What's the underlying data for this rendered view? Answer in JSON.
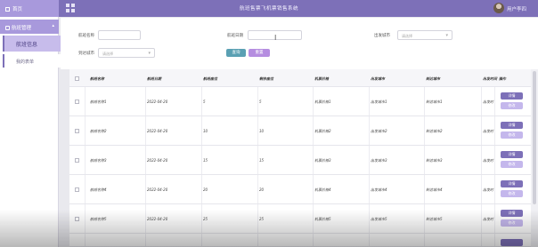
{
  "header": {
    "title": "航班售票飞机票销售系统",
    "user": "用户李四",
    "grid_icon": "grid-icon"
  },
  "sidebar": {
    "home": "首页",
    "group": "航班管理",
    "items": [
      {
        "label": "航班信息",
        "active": true
      },
      {
        "label": "我的表单",
        "active": false
      }
    ]
  },
  "search": {
    "flight_name_label": "航班名称",
    "flight_date_label": "航班日期",
    "depart_city_label": "出发城市",
    "depart_city_placeholder": "请选择",
    "arrive_city_label": "到达城市",
    "arrive_city_placeholder": "请选择",
    "search_button": "查询",
    "reset_button": "重置",
    "search_button_color": "#5aa0b3",
    "reset_button_color": "#b58de0"
  },
  "table": {
    "headers": [
      "航班名称",
      "航班日期",
      "航班座位",
      "剩余座位",
      "机票价格",
      "出发城市",
      "到达城市",
      "出发时间",
      "操作"
    ],
    "rows": [
      [
        "航班名称1",
        "2022-04-20",
        "5",
        "5",
        "机票价格1",
        "出发城市1",
        "到达城市1",
        "出发时"
      ],
      [
        "航班名称2",
        "2022-04-20",
        "10",
        "10",
        "机票价格2",
        "出发城市2",
        "到达城市2",
        "出发时"
      ],
      [
        "航班名称3",
        "2022-04-20",
        "15",
        "15",
        "机票价格3",
        "出发城市3",
        "到达城市3",
        "出发时"
      ],
      [
        "航班名称4",
        "2022-04-20",
        "20",
        "20",
        "机票价格4",
        "出发城市4",
        "到达城市4",
        "出发时"
      ],
      [
        "航班名称5",
        "2022-04-20",
        "25",
        "25",
        "机票价格5",
        "出发城市5",
        "到达城市5",
        "出发时"
      ]
    ],
    "view_button": "详情",
    "edit_button": "修改"
  }
}
